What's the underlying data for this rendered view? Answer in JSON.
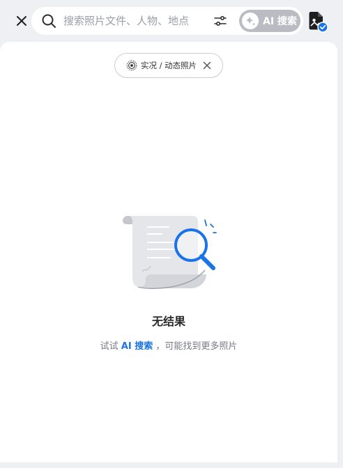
{
  "topbar": {
    "close_icon": "close-icon",
    "search": {
      "placeholder": "搜索照片文件、人物、地点",
      "value": ""
    },
    "filter_icon": "sliders-icon",
    "ai_button": {
      "label": "AI 搜索",
      "icon": "sparkle-icon",
      "background": "#b9bcc2"
    },
    "file_badge_icon": "file-check-icon"
  },
  "filter_chip": {
    "label": "实况 / 动态照片",
    "icon": "live-photo-icon",
    "close_icon": "close-icon"
  },
  "empty_state": {
    "illustration": "no-results-illustration",
    "title": "无结果",
    "hint_prefix": "试试",
    "hint_link": "AI 搜索",
    "hint_suffix": "，可能找到更多照片"
  },
  "colors": {
    "accent": "#1a73e8",
    "background": "#eef0f4",
    "panel": "#ffffff"
  }
}
